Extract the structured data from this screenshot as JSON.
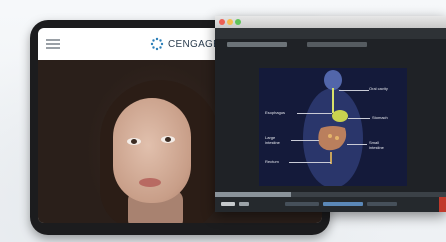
{
  "brand": {
    "name": "CENGAGE",
    "color": "#2c7fb8"
  },
  "tablet": {
    "menu_icon": "hamburger-menu-icon"
  },
  "monitor": {
    "window_controls": [
      {
        "name": "close",
        "color": "#ec5f55"
      },
      {
        "name": "minimize",
        "color": "#f5bd4f"
      },
      {
        "name": "maximize",
        "color": "#5fc35a"
      }
    ],
    "diagram_labels": {
      "oral_cavity": "Oral cavity",
      "esophagus": "Esophagus",
      "stomach": "Stomach",
      "large_intestine": "Large\nintestine",
      "small_intestine": "Small\nintestine",
      "rectum": "Rectum"
    },
    "playback_progress": 0.33
  }
}
